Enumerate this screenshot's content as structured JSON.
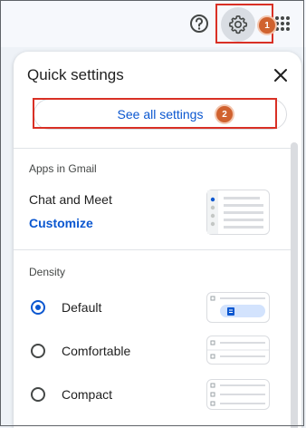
{
  "header": {
    "help_icon": "question-circle-icon",
    "settings_icon": "gear-icon",
    "apps_icon": "apps-grid-icon"
  },
  "annotations": {
    "step1": "1",
    "step2": "2",
    "color": "#d93025"
  },
  "panel": {
    "title": "Quick settings",
    "close_icon": "close-icon",
    "see_all_label": "See all settings",
    "apps_section": {
      "label": "Apps in Gmail",
      "item_label": "Chat and Meet",
      "customize_label": "Customize"
    },
    "density": {
      "label": "Density",
      "options": [
        {
          "label": "Default",
          "selected": true
        },
        {
          "label": "Comfortable",
          "selected": false
        },
        {
          "label": "Compact",
          "selected": false
        }
      ]
    }
  },
  "colors": {
    "accent": "#0b57d0",
    "background": "#f6f8fc",
    "badge": "#d0622f"
  }
}
